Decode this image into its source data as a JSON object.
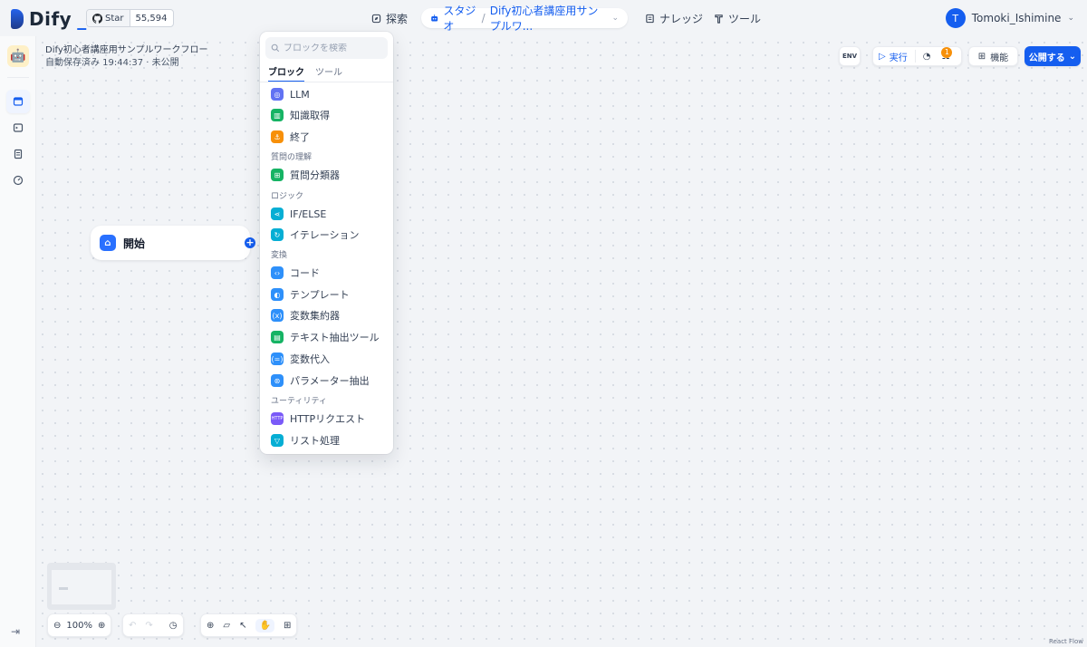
{
  "header": {
    "logo_text": "Dify",
    "github": {
      "star_label": "Star",
      "star_count": "55,594"
    },
    "nav": {
      "explore": "探索",
      "studio": "スタジオ",
      "app_name": "Dify初心者講座用サンプルワ...",
      "knowledge": "ナレッジ",
      "tools": "ツール"
    },
    "user": {
      "initial": "T",
      "name": "Tomoki_Ishimine"
    }
  },
  "workflow": {
    "title": "Dify初心者講座用サンプルワークフロー",
    "status": "自動保存済み 19:44:37 · 未公開"
  },
  "start_node": {
    "label": "開始"
  },
  "block_picker": {
    "search_placeholder": "ブロックを検索",
    "tabs": [
      "ブロック",
      "ツール"
    ],
    "items": {
      "llm": "LLM",
      "knowledge": "知識取得",
      "end": "終了",
      "section_understanding": "質問の理解",
      "classifier": "質問分類器",
      "section_logic": "ロジック",
      "ifelse": "IF/ELSE",
      "iteration": "イテレーション",
      "section_transform": "変換",
      "code": "コード",
      "template": "テンプレート",
      "var_agg": "変数集約器",
      "text_extract": "テキスト抽出ツール",
      "var_assign": "変数代入",
      "param_extract": "パラメーター抽出",
      "section_utility": "ユーティリティ",
      "http": "HTTPリクエスト",
      "list": "リスト処理"
    }
  },
  "toolbar": {
    "env_label": "ENV",
    "run_label": "実行",
    "checklist_count": "1",
    "features_label": "機能",
    "publish_label": "公開する"
  },
  "zoom": {
    "level": "100%"
  },
  "footer": {
    "reactflow": "React Flow"
  },
  "colors": {
    "accent": "#155eef",
    "warning": "#f79009"
  }
}
